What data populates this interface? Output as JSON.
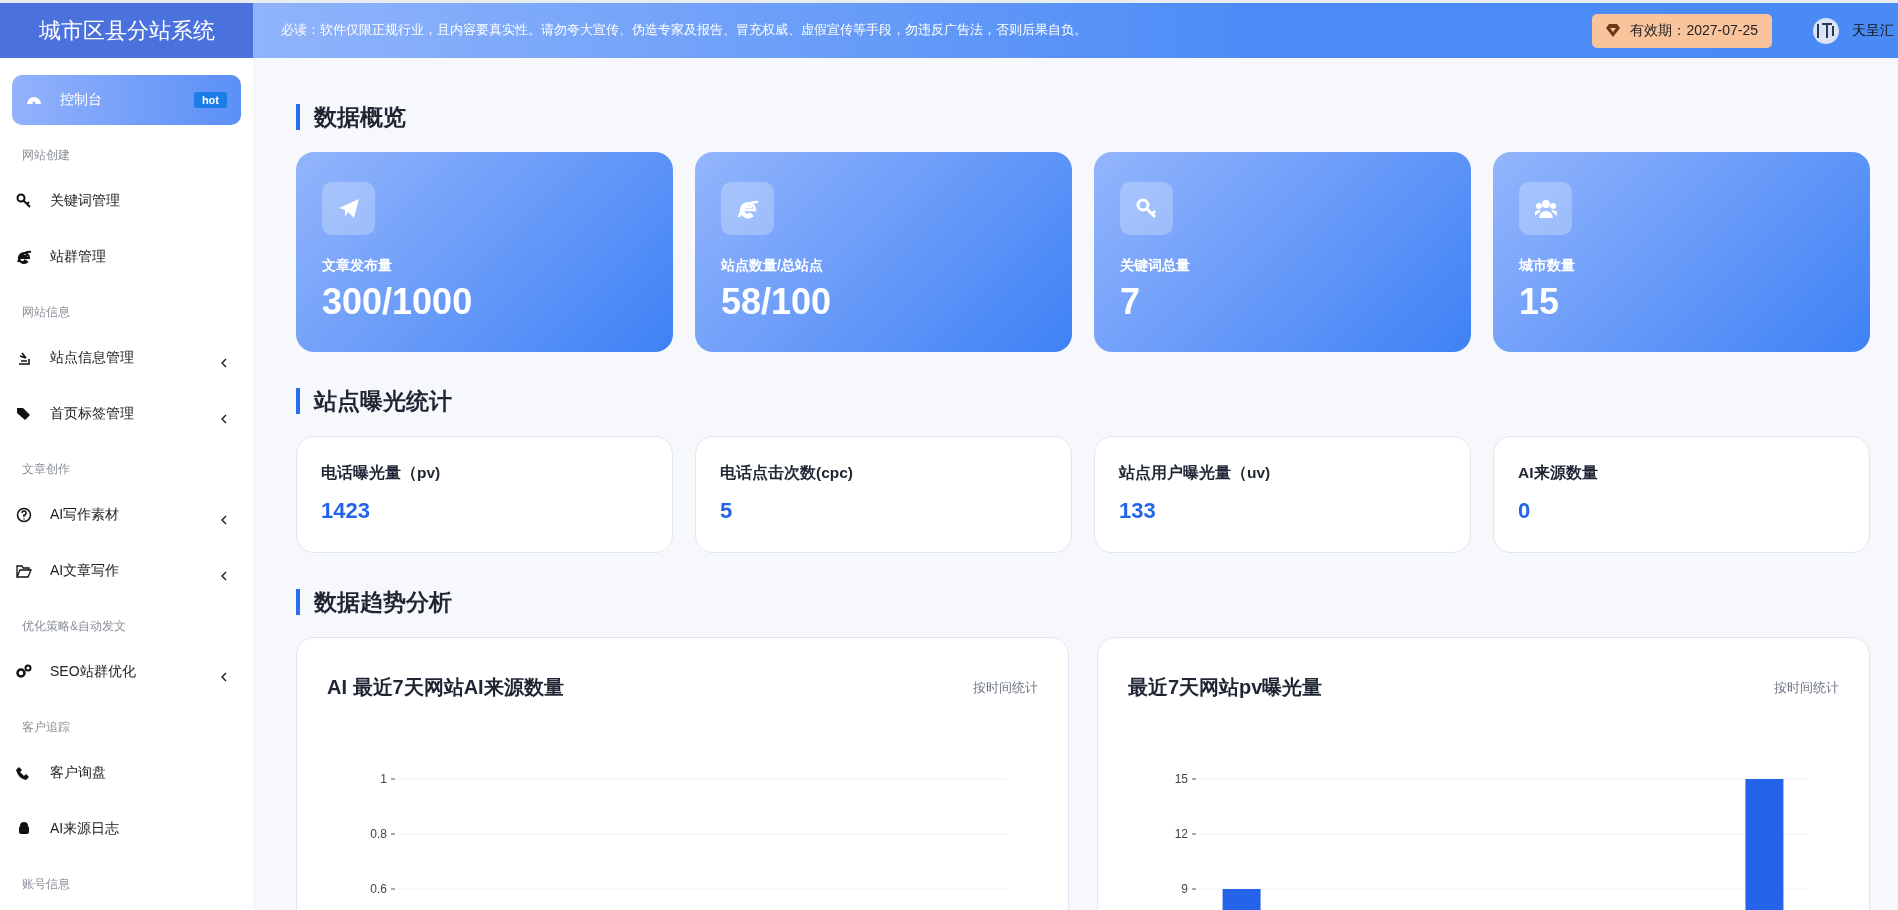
{
  "header": {
    "title": "城市区县分站系统",
    "notice": "必读：软件仅限正规行业，且内容要真实性。请勿夸大宣传、伪造专家及报告、冒充权威、虚假宣传等手段，勿违反广告法，否则后果自负。",
    "validity": "有效期：2027-07-25",
    "user": "天呈汇"
  },
  "sidebar": {
    "items": [
      {
        "kind": "item",
        "label": "控制台",
        "badge": "hot",
        "selected": true,
        "expandable": false
      },
      {
        "kind": "section",
        "label": "网站创建"
      },
      {
        "kind": "item",
        "label": "关键词管理",
        "selected": false,
        "expandable": false
      },
      {
        "kind": "item",
        "label": "站群管理",
        "selected": false,
        "expandable": false
      },
      {
        "kind": "section",
        "label": "网站信息"
      },
      {
        "kind": "item",
        "label": "站点信息管理",
        "selected": false,
        "expandable": true
      },
      {
        "kind": "item",
        "label": "首页标签管理",
        "selected": false,
        "expandable": true
      },
      {
        "kind": "section",
        "label": "文章创作"
      },
      {
        "kind": "item",
        "label": "AI写作素材",
        "selected": false,
        "expandable": true
      },
      {
        "kind": "item",
        "label": "AI文章写作",
        "selected": false,
        "expandable": true
      },
      {
        "kind": "section",
        "label": "优化策略&自动发文"
      },
      {
        "kind": "item",
        "label": "SEO站群优化",
        "selected": false,
        "expandable": true
      },
      {
        "kind": "section",
        "label": "客户追踪"
      },
      {
        "kind": "item",
        "label": "客户询盘",
        "selected": false,
        "expandable": false
      },
      {
        "kind": "item",
        "label": "AI来源日志",
        "selected": false,
        "expandable": false
      },
      {
        "kind": "section",
        "label": "账号信息"
      }
    ]
  },
  "overview": {
    "title": "数据概览",
    "cards": [
      {
        "label": "文章发布量",
        "value": "300/1000"
      },
      {
        "label": "站点数量/总站点",
        "value": "58/100"
      },
      {
        "label": "关键词总量",
        "value": "7"
      },
      {
        "label": "城市数量",
        "value": "15"
      }
    ]
  },
  "exposure": {
    "title": "站点曝光统计",
    "cards": [
      {
        "label": "电话曝光量（pv)",
        "value": "1423"
      },
      {
        "label": "电话点击次数(cpc)",
        "value": "5"
      },
      {
        "label": "站点用户曝光量（uv)",
        "value": "133"
      },
      {
        "label": "AI来源数量",
        "value": "0"
      }
    ]
  },
  "trends": {
    "title": "数据趋势分析",
    "charts": [
      {
        "title": "AI 最近7天网站AI来源数量",
        "filter": "按时间统计",
        "axis_labels": [
          "1",
          "0.8",
          "0.6"
        ]
      },
      {
        "title": "最近7天网站pv曝光量",
        "filter": "按时间统计",
        "chart_data": {
          "type": "bar",
          "ylim": [
            0,
            15
          ],
          "yticks": [
            15,
            12,
            9
          ],
          "values": [
            9,
            null,
            null,
            null,
            null,
            null,
            15
          ]
        }
      }
    ]
  }
}
